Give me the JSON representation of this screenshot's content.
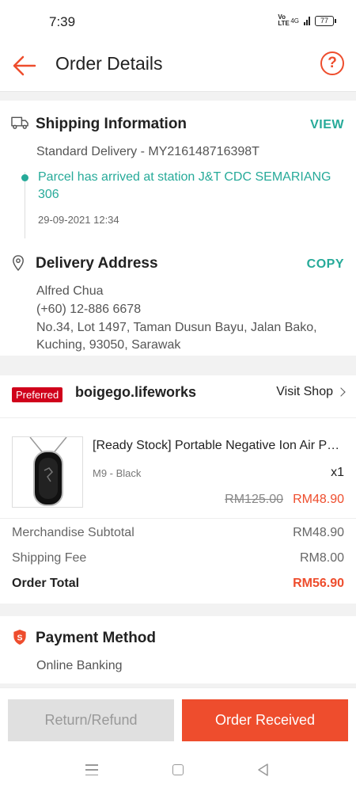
{
  "status_bar": {
    "time": "7:39",
    "network": "4G",
    "volte": "Vo LTE",
    "battery": "77"
  },
  "header": {
    "title": "Order Details"
  },
  "shipping": {
    "title": "Shipping Information",
    "action": "VIEW",
    "method": "Standard Delivery - MY216148716398T",
    "status": "Parcel has arrived at station J&T CDC SEMARIANG 306",
    "timestamp": "29-09-2021 12:34"
  },
  "address": {
    "title": "Delivery Address",
    "action": "COPY",
    "name": "Alfred Chua",
    "phone": "(+60) 12-886 6678",
    "line1": "No.34, Lot 1497, Taman Dusun Bayu, Jalan Bako,",
    "line2": "Kuching, 93050, Sarawak"
  },
  "shop": {
    "badge": "Preferred",
    "name": "boigego.lifeworks",
    "visit_label": "Visit Shop"
  },
  "product": {
    "name": "[Ready Stock] Portable Negative Ion Air Purifier Necklace",
    "variant": "M9 - Black",
    "quantity": "x1",
    "original_price": "RM125.00",
    "price": "RM48.90"
  },
  "summary": {
    "subtotal_label": "Merchandise Subtotal",
    "subtotal_value": "RM48.90",
    "shipping_label": "Shipping Fee",
    "shipping_value": "RM8.00",
    "total_label": "Order Total",
    "total_value": "RM56.90"
  },
  "payment": {
    "title": "Payment Method",
    "method": "Online Banking"
  },
  "actions": {
    "refund_label": "Return/Refund",
    "received_label": "Order Received"
  },
  "colors": {
    "accent": "#ee4d2d",
    "teal": "#26aa99",
    "badge": "#d0011b"
  }
}
